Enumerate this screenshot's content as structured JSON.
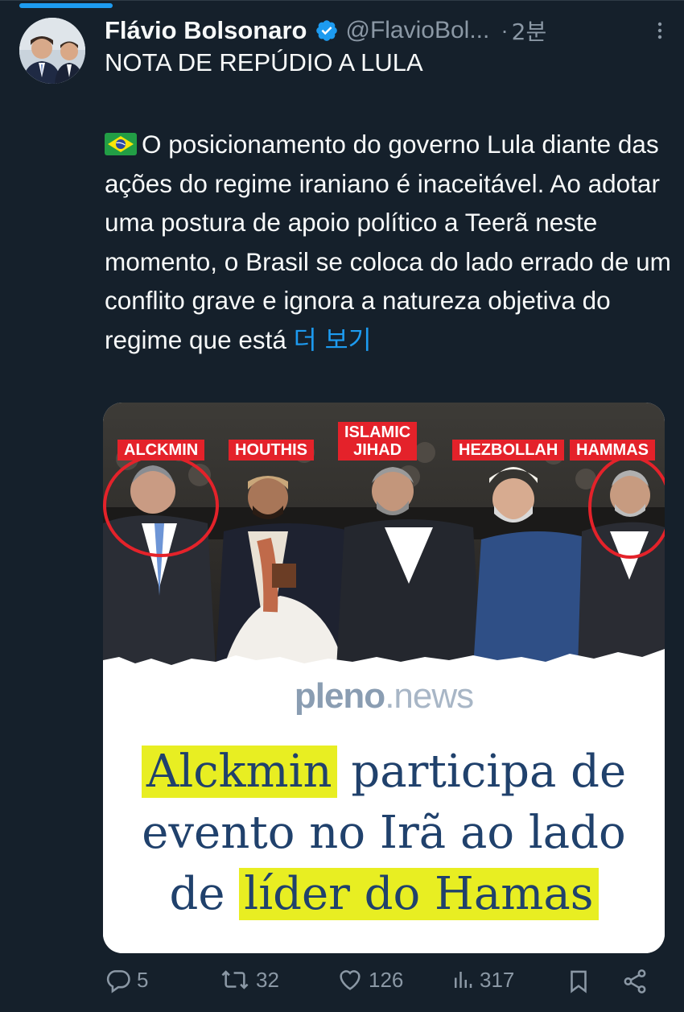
{
  "tweet": {
    "author_name": "Flávio Bolsonaro",
    "handle": "@FlavioBol...",
    "separator": "·",
    "time": "2분",
    "headline": "NOTA DE REPÚDIO A LULA",
    "body": "O posicionamento do governo Lula diante das ações do regime iraniano é inaceitável. Ao adotar uma postura de apoio político a Teerã neste momento, o Brasil se coloca do lado errado de um conflito grave e ignora a natureza objetiva do regime que está",
    "show_more": "더 보기",
    "flag_icon": "brazil-flag-icon"
  },
  "media": {
    "labels": [
      "ALCKMIN",
      "HOUTHIS",
      "ISLAMIC JIHAD",
      "HEZBOLLAH",
      "HAMMAS"
    ],
    "label_islamic_1": "ISLAMIC",
    "label_islamic_2": "JIHAD",
    "brand_bold": "pleno",
    "brand_light": ".news",
    "title_line1_highlight": "Alckmin",
    "title_line1_rest": " participa de",
    "title_line2": "evento no Irã ao lado",
    "title_line3_pre": "de ",
    "title_line3_highlight": "líder do Hamas",
    "highlight_color": "#e8ee22",
    "label_color": "#e4222a",
    "title_color": "#20416c"
  },
  "actions": {
    "replies": "5",
    "retweets": "32",
    "likes": "126",
    "views": "317"
  },
  "colors": {
    "background": "#15202b",
    "text": "#f7f9f9",
    "muted": "#8b98a5",
    "link": "#1d9bf0"
  }
}
